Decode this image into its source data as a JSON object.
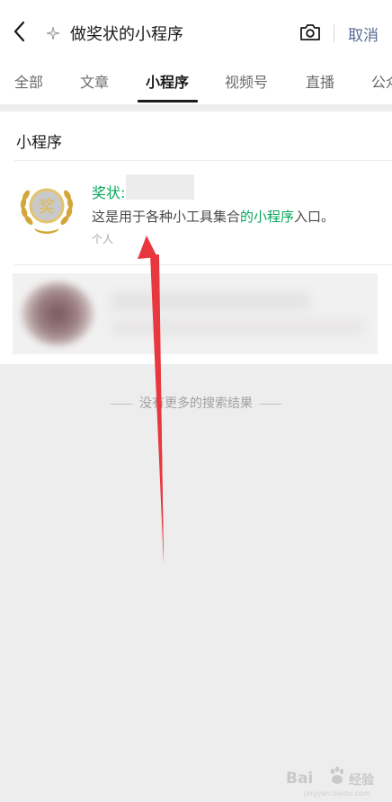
{
  "header": {
    "query": "做奖状的小程序",
    "cancel_label": "取消",
    "icons": [
      "back-icon",
      "sparkle-icon",
      "camera-icon"
    ]
  },
  "tabs": [
    {
      "label": "全部",
      "active": false
    },
    {
      "label": "文章",
      "active": false
    },
    {
      "label": "小程序",
      "active": true
    },
    {
      "label": "视频号",
      "active": false
    },
    {
      "label": "直播",
      "active": false
    },
    {
      "label": "公众号",
      "active": false
    }
  ],
  "section": {
    "title": "小程序"
  },
  "result": {
    "name": "奖状:",
    "desc_before": "这是用于各种小工具集合",
    "desc_highlight": "的小程序",
    "desc_after": "入口。",
    "owner": "个人",
    "logo_char": "奖"
  },
  "footer": {
    "no_more": "没有更多的搜索结果"
  },
  "watermark": {
    "brand": "Bai",
    "brand_suffix": "经验",
    "sub": "jingyan.baidu.com"
  },
  "colors": {
    "accent_green": "#07a65b",
    "link_blue": "#576b95",
    "arrow_red": "#e8373f"
  }
}
